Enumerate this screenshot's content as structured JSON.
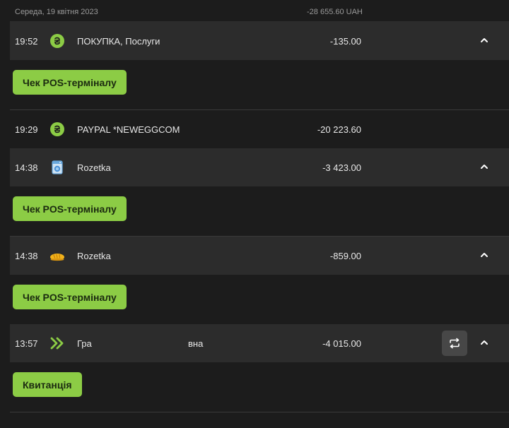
{
  "header": {
    "date": "Середа, 19 квітня 2023",
    "total": "-28 655.60 UAH"
  },
  "transactions": [
    {
      "time": "19:52",
      "icon": "hryvnia-icon",
      "description": "ПОКУПКА, Послуги",
      "description_extra": "",
      "amount": "-135.00",
      "expanded": true,
      "action_label": "Чек POS-терміналу"
    },
    {
      "time": "19:29",
      "icon": "hryvnia-icon",
      "description": "PAYPAL *NEWEGGCOM",
      "description_extra": "",
      "amount": "-20 223.60",
      "expanded": false
    },
    {
      "time": "14:38",
      "icon": "washing-machine-icon",
      "description": "Rozetka",
      "description_extra": "",
      "amount": "-3 423.00",
      "expanded": true,
      "action_label": "Чек POS-терміналу"
    },
    {
      "time": "14:38",
      "icon": "bread-icon",
      "description": "Rozetka",
      "description_extra": "",
      "amount": "-859.00",
      "expanded": true,
      "action_label": "Чек POS-терміналу"
    },
    {
      "time": "13:57",
      "icon": "transfer-arrows-icon",
      "description": "Гра",
      "description_extra": "вна",
      "amount": "-4 015.00",
      "expanded": true,
      "action_label": "Квитанція"
    }
  ],
  "colors": {
    "accent": "#8ccc45",
    "background": "#1c1c1c",
    "row_dark": "#2c2c2c"
  }
}
